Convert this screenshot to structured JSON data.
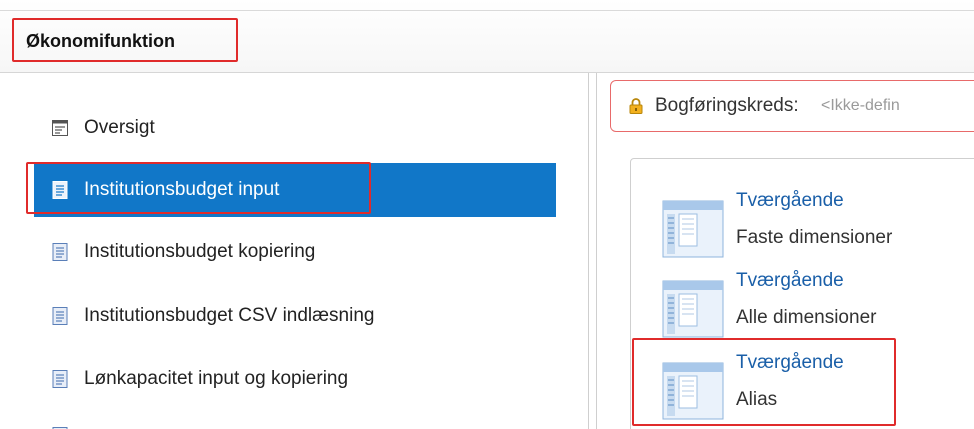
{
  "header": {
    "title": "Økonomifunktion"
  },
  "nav": {
    "items": [
      {
        "label": "Oversigt",
        "icon": "form-icon"
      },
      {
        "label": "Institutionsbudget input",
        "icon": "document-icon",
        "active": true
      },
      {
        "label": "Institutionsbudget kopiering",
        "icon": "document-icon"
      },
      {
        "label": "Institutionsbudget CSV indlæsning",
        "icon": "document-icon"
      },
      {
        "label": "Lønkapacitet input og kopiering",
        "icon": "document-icon"
      }
    ]
  },
  "notice": {
    "label": "Bogføringskreds:",
    "value": "<Ikke-defin",
    "icon": "lock-icon"
  },
  "tiles": [
    {
      "title": "Tværgående",
      "subtitle": "Faste dimensioner"
    },
    {
      "title": "Tværgående",
      "subtitle": "Alle dimensioner"
    },
    {
      "title": "Tværgående",
      "subtitle": "Alias"
    }
  ],
  "colors": {
    "accent": "#1177c8",
    "highlight": "#e02b2b",
    "link": "#1a5fa8"
  }
}
